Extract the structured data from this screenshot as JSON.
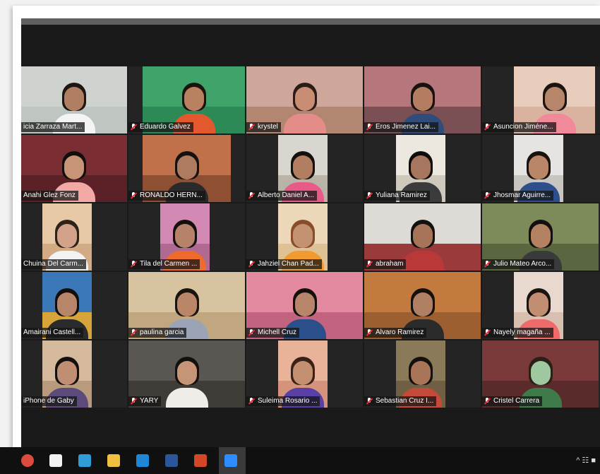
{
  "participants": [
    {
      "name": "icia Zarraza Mart...",
      "muted": false,
      "active": true,
      "wall": "#cfd3cf",
      "floor": "#bfc5c0",
      "shirt": "#f4f4f4",
      "skin": "#b07f63",
      "hair": "#1d1612"
    },
    {
      "name": "Eduardo Galvez",
      "muted": true,
      "active": false,
      "wall": "#3fa36a",
      "floor": "#2d8a57",
      "shirt": "#e4582e",
      "skin": "#b9815f",
      "hair": "#1a1410"
    },
    {
      "name": "krystel",
      "muted": true,
      "active": false,
      "wall": "#cfa79a",
      "floor": "#b38672",
      "shirt": "#e48d88",
      "skin": "#c88d73",
      "hair": "#2a1d18"
    },
    {
      "name": "Eros Jimenez Lai...",
      "muted": true,
      "active": false,
      "wall": "#b6777c",
      "floor": "#7a5055",
      "shirt": "#2f4c7a",
      "skin": "#b47d62",
      "hair": "#17120f"
    },
    {
      "name": "Asuncion Jiméne...",
      "muted": true,
      "active": false,
      "wall": "#e8cdbc",
      "floor": "#d9b3a0",
      "shirt": "#f0899a",
      "skin": "#b7856a",
      "hair": "#1b1411"
    },
    {
      "name": "Anahi Glez Fonz",
      "muted": false,
      "active": false,
      "wall": "#7a2e33",
      "floor": "#5c2126",
      "shirt": "#f2a9a6",
      "skin": "#c79478",
      "hair": "#130f0d"
    },
    {
      "name": "RONALDO HERN...",
      "muted": true,
      "active": false,
      "wall": "#c1714a",
      "floor": "#8f4f33",
      "shirt": "#2a2a2a",
      "skin": "#ad7c60",
      "hair": "#15110f"
    },
    {
      "name": "Alberto Daniel A...",
      "muted": true,
      "active": false,
      "wall": "#d9d6cf",
      "floor": "#b9b3a8",
      "shirt": "#e85a88",
      "skin": "#b27e62",
      "hair": "#14100d"
    },
    {
      "name": "Yuliana Ramirez",
      "muted": true,
      "active": false,
      "wall": "#ece7df",
      "floor": "#cfc8bd",
      "shirt": "#3b3b3b",
      "skin": "#a6775e",
      "hair": "#0f0c0a"
    },
    {
      "name": "Jhosmar Aguirre...",
      "muted": true,
      "active": false,
      "wall": "#e6e4e2",
      "floor": "#c8c4c0",
      "shirt": "#2e4f8c",
      "skin": "#b98667",
      "hair": "#18130f"
    },
    {
      "name": "Chuina Del Carm...",
      "muted": false,
      "active": false,
      "wall": "#e7c9a8",
      "floor": "#d2aa83",
      "shirt": "#f2f2f2",
      "skin": "#d3a288",
      "hair": "#2f2219"
    },
    {
      "name": "Tila del Carmen ...",
      "muted": true,
      "active": false,
      "wall": "#d28ab4",
      "floor": "#b06a91",
      "shirt": "#ef6a2d",
      "skin": "#b6836a",
      "hair": "#14100d"
    },
    {
      "name": "Jahziel Chan Pad...",
      "muted": true,
      "active": false,
      "wall": "#ecd7b8",
      "floor": "#dfc196",
      "shirt": "#f19a2f",
      "skin": "#c39272",
      "hair": "#8a4d2a"
    },
    {
      "name": "abraham",
      "muted": true,
      "active": false,
      "wall": "#dedbd6",
      "floor": "#9b3a3a",
      "shirt": "#b93838",
      "skin": "#a87459",
      "hair": "#13100d"
    },
    {
      "name": "Julio Mateo Arco...",
      "muted": true,
      "active": false,
      "wall": "#7d8a5a",
      "floor": "#5a6640",
      "shirt": "#3a3a3a",
      "skin": "#b58163",
      "hair": "#14100d"
    },
    {
      "name": "Amairani Castell...",
      "muted": false,
      "active": false,
      "wall": "#3b78b8",
      "floor": "#d7a43a",
      "shirt": "#2b2b2b",
      "skin": "#b7856a",
      "hair": "#120f0d"
    },
    {
      "name": "paulina garcia",
      "muted": true,
      "active": false,
      "wall": "#d8c3a0",
      "floor": "#c1a77f",
      "shirt": "#9aa4b6",
      "skin": "#b98768",
      "hair": "#1a1410"
    },
    {
      "name": "Michell Cruz",
      "muted": true,
      "active": false,
      "wall": "#e48aa0",
      "floor": "#c26480",
      "shirt": "#2b4f8a",
      "skin": "#b8856a",
      "hair": "#130f0d"
    },
    {
      "name": "Alvaro Ramirez",
      "muted": true,
      "active": false,
      "wall": "#c27a3e",
      "floor": "#9d5f2f",
      "shirt": "#2b2b2b",
      "skin": "#b08064",
      "hair": "#14100d"
    },
    {
      "name": "Nayely magaña ...",
      "muted": true,
      "active": false,
      "wall": "#e9d8ce",
      "floor": "#d9bfb0",
      "shirt": "#ef6a6a",
      "skin": "#c18e72",
      "hair": "#1a1410"
    },
    {
      "name": "iPhone de Gaby",
      "muted": false,
      "active": false,
      "wall": "#d4b99d",
      "floor": "#b99a7c",
      "shirt": "#5c4b7a",
      "skin": "#c08e72",
      "hair": "#14100d"
    },
    {
      "name": "YARY",
      "muted": true,
      "active": false,
      "wall": "#5a5652",
      "floor": "#3f3b37",
      "shirt": "#f0ece7",
      "skin": "#c69577",
      "hair": "#14100d"
    },
    {
      "name": "Suleima Rosario ...",
      "muted": true,
      "active": false,
      "wall": "#e9b39a",
      "floor": "#d4937a",
      "shirt": "#5a3fa6",
      "skin": "#c49072",
      "hair": "#3a2216"
    },
    {
      "name": "Sebastian Cruz I...",
      "muted": true,
      "active": false,
      "wall": "#8a7a5a",
      "floor": "#6f5f44",
      "shirt": "#c44a3a",
      "skin": "#a87559",
      "hair": "#14100d"
    },
    {
      "name": "Cristel Carrera",
      "muted": true,
      "active": false,
      "wall": "#7a3a3a",
      "floor": "#5b2a2a",
      "shirt": "#3f7a4a",
      "skin": "#9fc7a0",
      "hair": "#2a2018"
    }
  ],
  "taskbar": {
    "icons": [
      "chrome-icon",
      "store-icon",
      "edge-icon",
      "file-explorer-icon",
      "mail-icon",
      "word-icon",
      "powerpoint-icon",
      "zoom-icon"
    ],
    "tray": "^ ☷ ■"
  }
}
